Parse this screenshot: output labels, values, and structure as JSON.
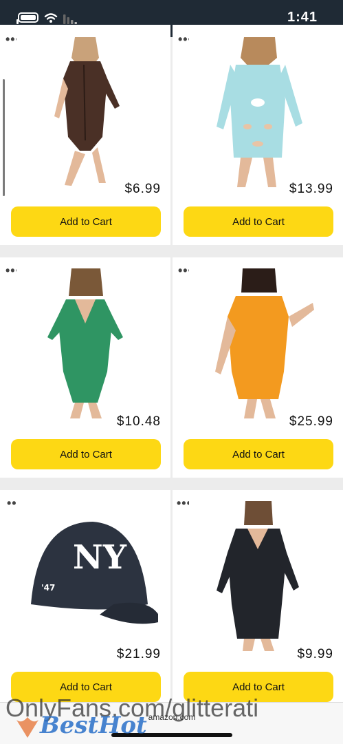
{
  "status_bar": {
    "time": "1:41",
    "icons": [
      "battery-icon",
      "wifi-icon",
      "signal-icon"
    ]
  },
  "products": [
    {
      "price": "$6.99",
      "add_label": "Add to Cart",
      "image": "brown-romper"
    },
    {
      "price": "$13.99",
      "add_label": "Add to Cart",
      "image": "light-blue-cutout-dress"
    },
    {
      "price": "$10.48",
      "add_label": "Add to Cart",
      "image": "green-romper"
    },
    {
      "price": "$25.99",
      "add_label": "Add to Cart",
      "image": "orange-romper"
    },
    {
      "price": "$21.99",
      "add_label": "Add to Cart",
      "image": "ny-baseball-cap"
    },
    {
      "price": "$9.99",
      "add_label": "Add to Cart",
      "image": "black-romper"
    }
  ],
  "more_icon": "more-dots-icon",
  "bottom_bar": {
    "domain": "amazon.com"
  },
  "watermark": {
    "text": "OnlyFans.com/glitterati",
    "logo": "BestHot"
  },
  "colors": {
    "button": "#fdd814",
    "status_bar": "#1f2a35"
  }
}
